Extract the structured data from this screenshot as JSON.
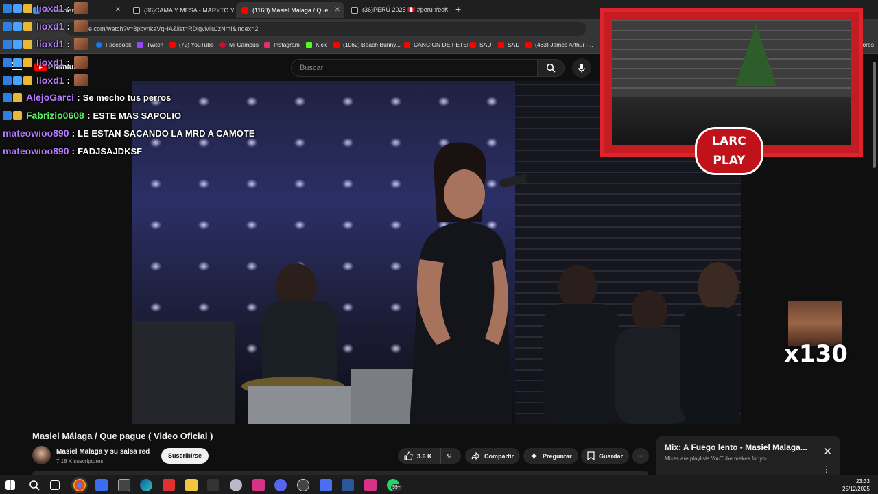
{
  "browser": {
    "tabs": [
      {
        "label": "Nuevo plan de",
        "icon": "doc-icon"
      },
      {
        "label": "(36)CAMA Y MESA - MARYTO Y",
        "icon": "tiktok-icon"
      },
      {
        "label": "(1160) Masiel Málaga / Que",
        "icon": "youtube-icon"
      },
      {
        "label": "(36)PERÚ 2025 🇵🇪 #peru #edit",
        "icon": "tiktok-icon"
      }
    ],
    "url": "ube.com/watch?v=8pbynkaVqHA&list=RDlgvMluJzNmI&index=2",
    "bookmarks": [
      {
        "label": "k",
        "color": "#ff0000"
      },
      {
        "label": "Facebook",
        "color": "#1877f2"
      },
      {
        "label": "Twitch",
        "color": "#9146ff"
      },
      {
        "label": "(72) YouTube",
        "color": "#ff0000"
      },
      {
        "label": "Mi Campus",
        "color": "#c8102e"
      },
      {
        "label": "Instagram",
        "color": "#e1306c"
      },
      {
        "label": "Kick",
        "color": "#53fc18"
      },
      {
        "label": "(1062) Beach Bunny...",
        "color": "#ff0000"
      },
      {
        "label": "CANCION DE PETER",
        "color": "#ff0000"
      },
      {
        "label": "SAU",
        "color": "#ff0000"
      },
      {
        "label": "SAD",
        "color": "#ff0000"
      },
      {
        "label": "(463) James Arthur -...",
        "color": "#ff0000"
      },
      {
        "label": "adores",
        "color": "#ff0000"
      }
    ]
  },
  "youtube": {
    "logo_label": "Premium",
    "search_placeholder": "Buscar",
    "video_title": "Masiel Málaga / Que pague ( Video Oficial )",
    "channel_name": "Masiel Malaga y su salsa red",
    "subscribers": "7.18 K suscriptores",
    "subscribe_label": "Suscribirse",
    "like_count": "3.6 K",
    "share_label": "Compartir",
    "ask_label": "Preguntar",
    "save_label": "Guardar",
    "mix_title": "Mix: A Fuego lento - Masiel Malaga...",
    "mix_subtitle": "Mixes are playlists YouTube makes for you"
  },
  "chat": [
    {
      "user": "lioxd1",
      "color": "#b77bff",
      "message": "",
      "emote": true
    },
    {
      "user": "lioxd1",
      "color": "#b77bff",
      "message": "",
      "emote": true
    },
    {
      "user": "lioxd1",
      "color": "#b77bff",
      "message": "",
      "emote": true
    },
    {
      "user": "lioxd1",
      "color": "#b77bff",
      "message": "",
      "emote": true
    },
    {
      "user": "lioxd1",
      "color": "#b77bff",
      "message": "",
      "emote": true
    },
    {
      "user": "AlejoGarci",
      "color": "#b77bff",
      "message": "Se mecho tus perros",
      "emote": false
    },
    {
      "user": "Fabrizio0608",
      "color": "#5df263",
      "message": "ESTE MAS SAPOLIO",
      "emote": false
    },
    {
      "user": "mateowioo890",
      "color": "#b77bff",
      "message": "LE ESTAN SACANDO LA MRD A CAMOTE",
      "emote": false
    },
    {
      "user": "mateowioo890",
      "color": "#b77bff",
      "message": "FADJSAJDKSF",
      "emote": false
    }
  ],
  "overlay": {
    "brand_line1": "LARC",
    "brand_line2": "PLAY",
    "combo_count": "x130"
  },
  "taskbar": {
    "time": "23:33",
    "date": "25/12/2025",
    "notification_badge": "99+"
  },
  "colors": {
    "accent_red": "#ff0000",
    "overlay_red": "#e0222c"
  }
}
